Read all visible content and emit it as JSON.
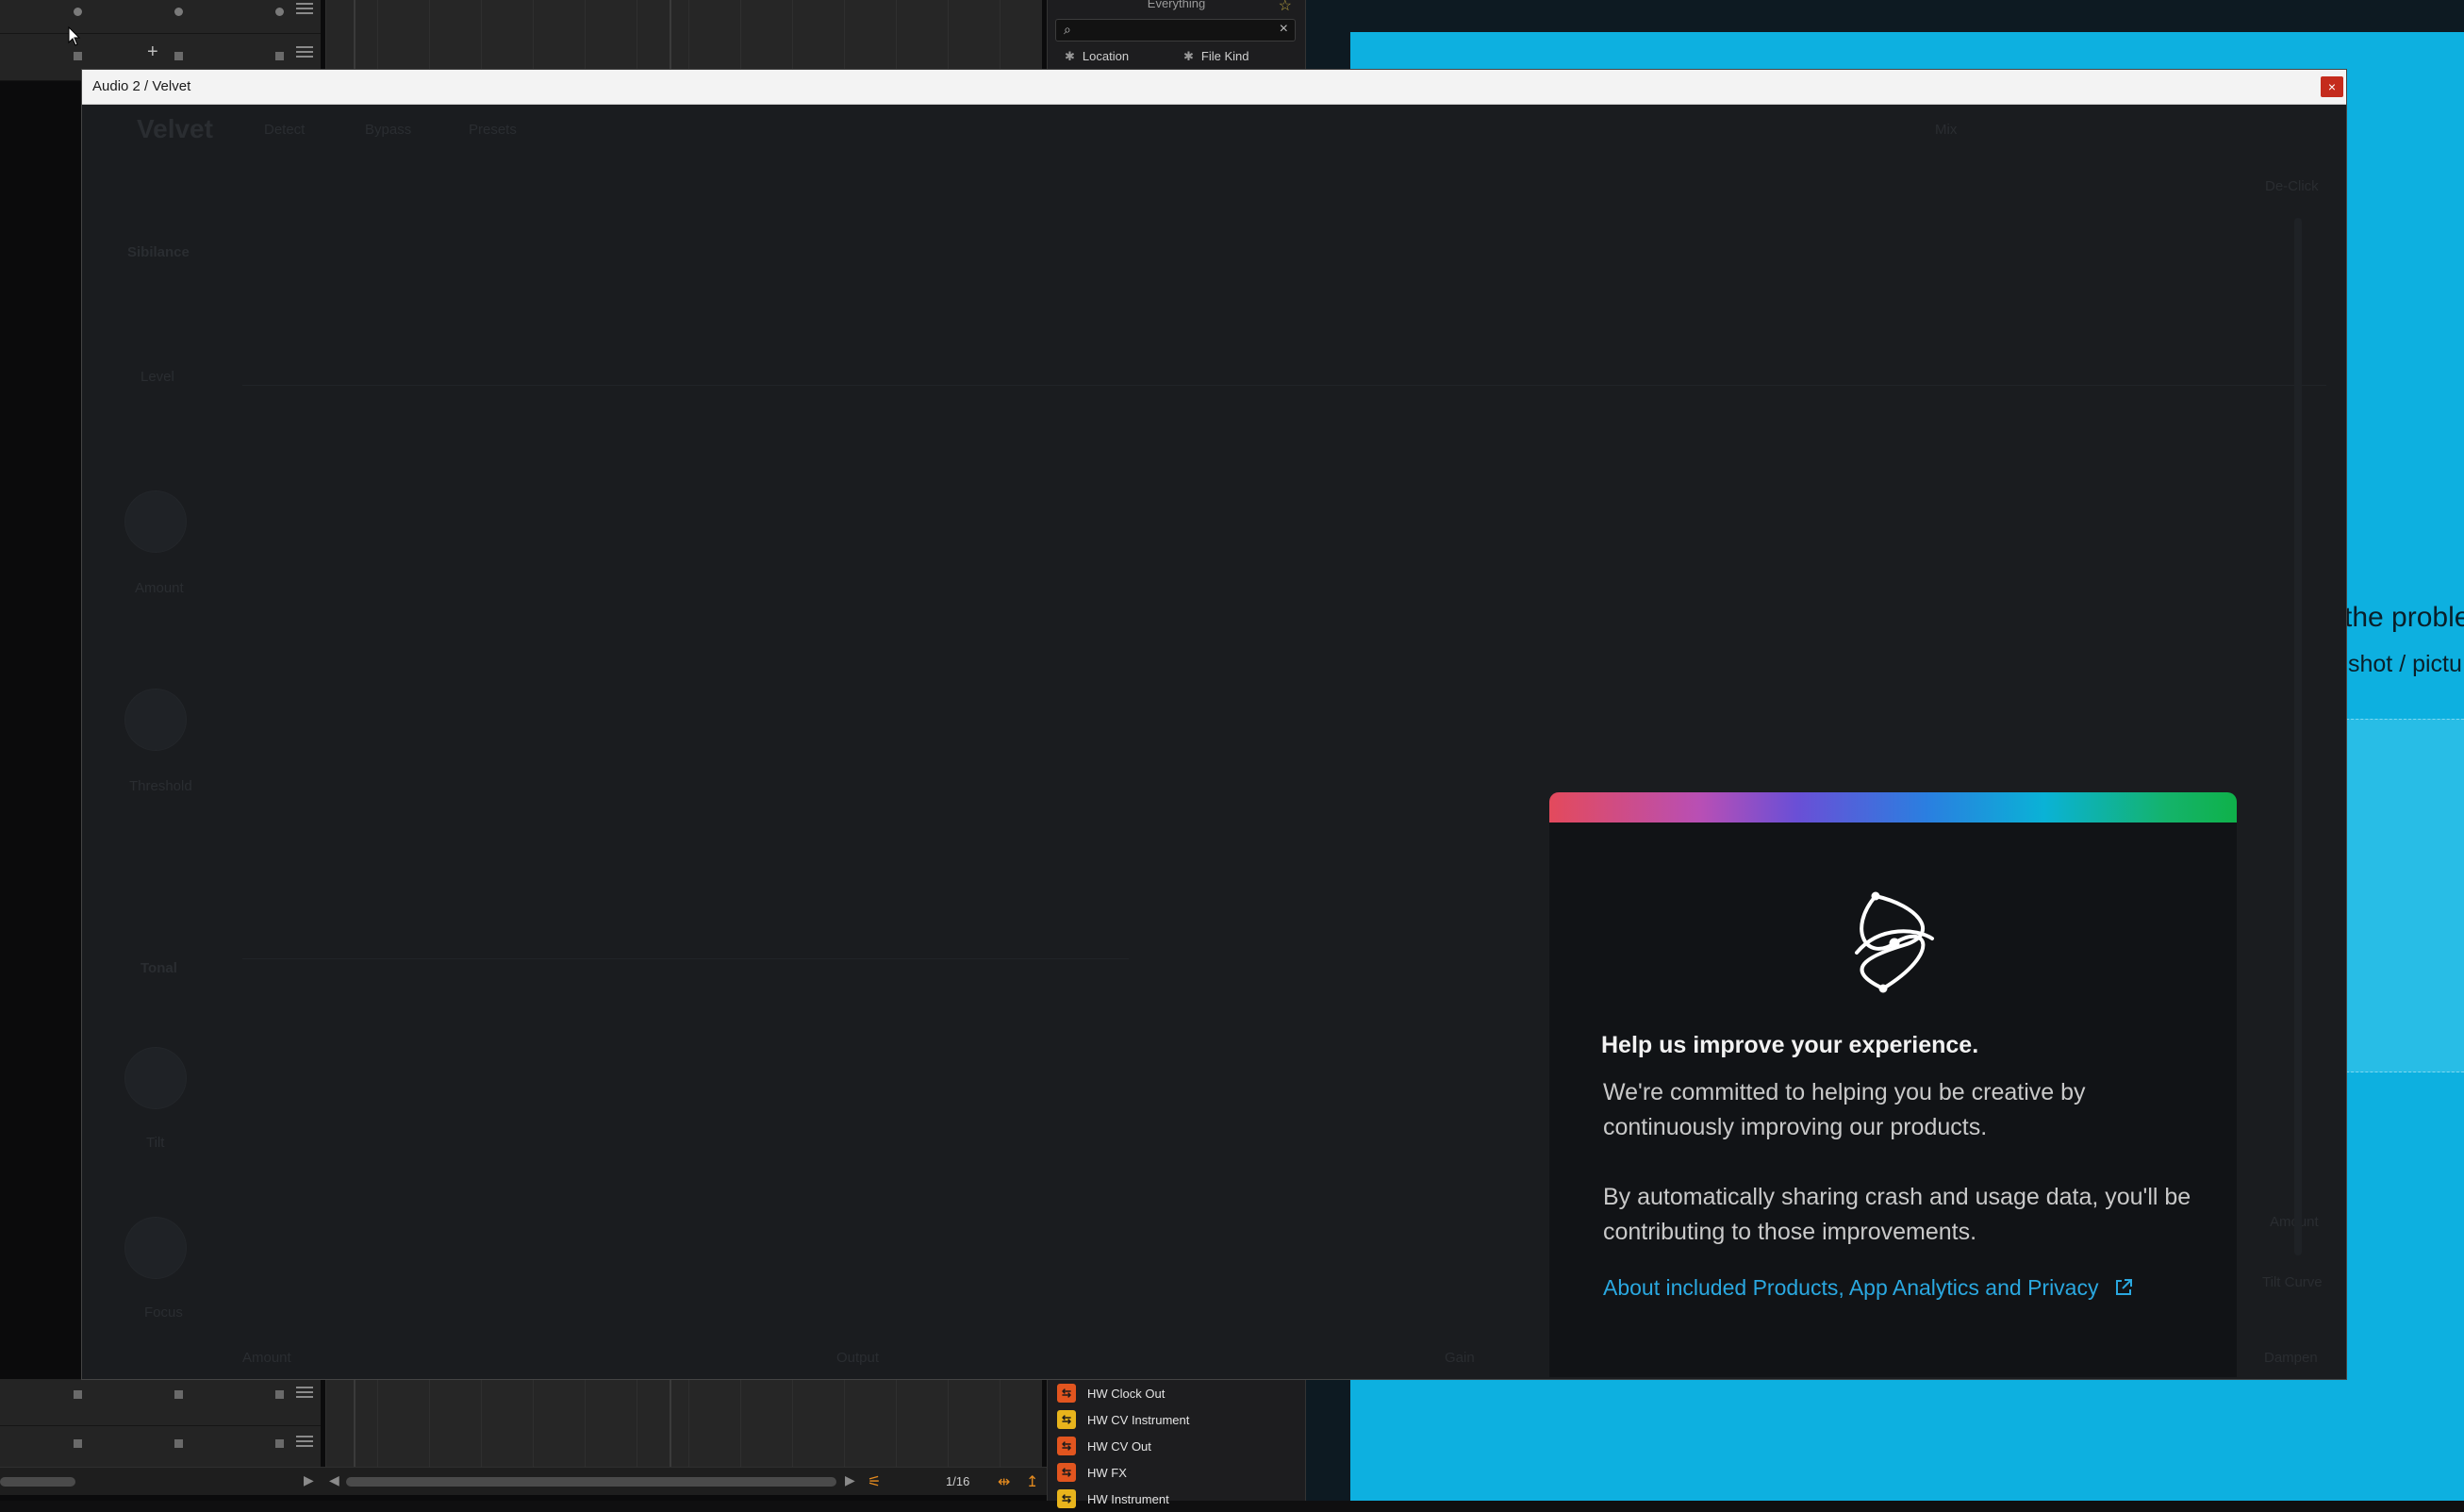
{
  "window": {
    "title": "Audio 2 / Velvet",
    "close_glyph": "×"
  },
  "plugin_faint": {
    "brand": "Velvet",
    "btn_a": "Detect",
    "btn_b": "Bypass",
    "preset": "Presets",
    "mix": "Mix",
    "sibilance": "Sibilance",
    "level": "Level",
    "de_click": "De-Click",
    "amount": "Amount",
    "threshold": "Threshold",
    "tonal": "Tonal",
    "tilt": "Tilt",
    "focus": "Focus",
    "bottom_a": "Amount",
    "bottom_b": "Output",
    "bottom_c": "Gain",
    "right_a": "Amount",
    "right_b": "Tilt Curve",
    "right_c": "Dampen"
  },
  "browser": {
    "title": "Everything",
    "filters": [
      "Location",
      "File Kind"
    ],
    "items": [
      {
        "label": "HW Clock Out",
        "color": "#e2551f",
        "icon": "device-icon"
      },
      {
        "label": "HW CV Instrument",
        "color": "#e8b41c",
        "icon": "device-icon"
      },
      {
        "label": "HW CV Out",
        "color": "#e2551f",
        "icon": "device-icon"
      },
      {
        "label": "HW FX",
        "color": "#e2551f",
        "icon": "device-icon"
      },
      {
        "label": "HW Instrument",
        "color": "#e8b41c",
        "icon": "device-icon"
      }
    ]
  },
  "transport": {
    "grid_value": "1/16"
  },
  "blue_app": {
    "heading_partial": "the proble",
    "sub_partial": "shot / pictu"
  },
  "dialog": {
    "title": "Help us improve your experience.",
    "paragraph1": "We're committed to helping you be creative by continuously improving our products.",
    "paragraph2": "By automatically sharing crash and usage data, you'll be contributing to those improvements.",
    "link_text": "About included Products, App Analytics and Privacy",
    "gradient_colors": [
      "#e34a5c",
      "#6a4fd6",
      "#0ab2d6",
      "#0fb14a"
    ]
  }
}
